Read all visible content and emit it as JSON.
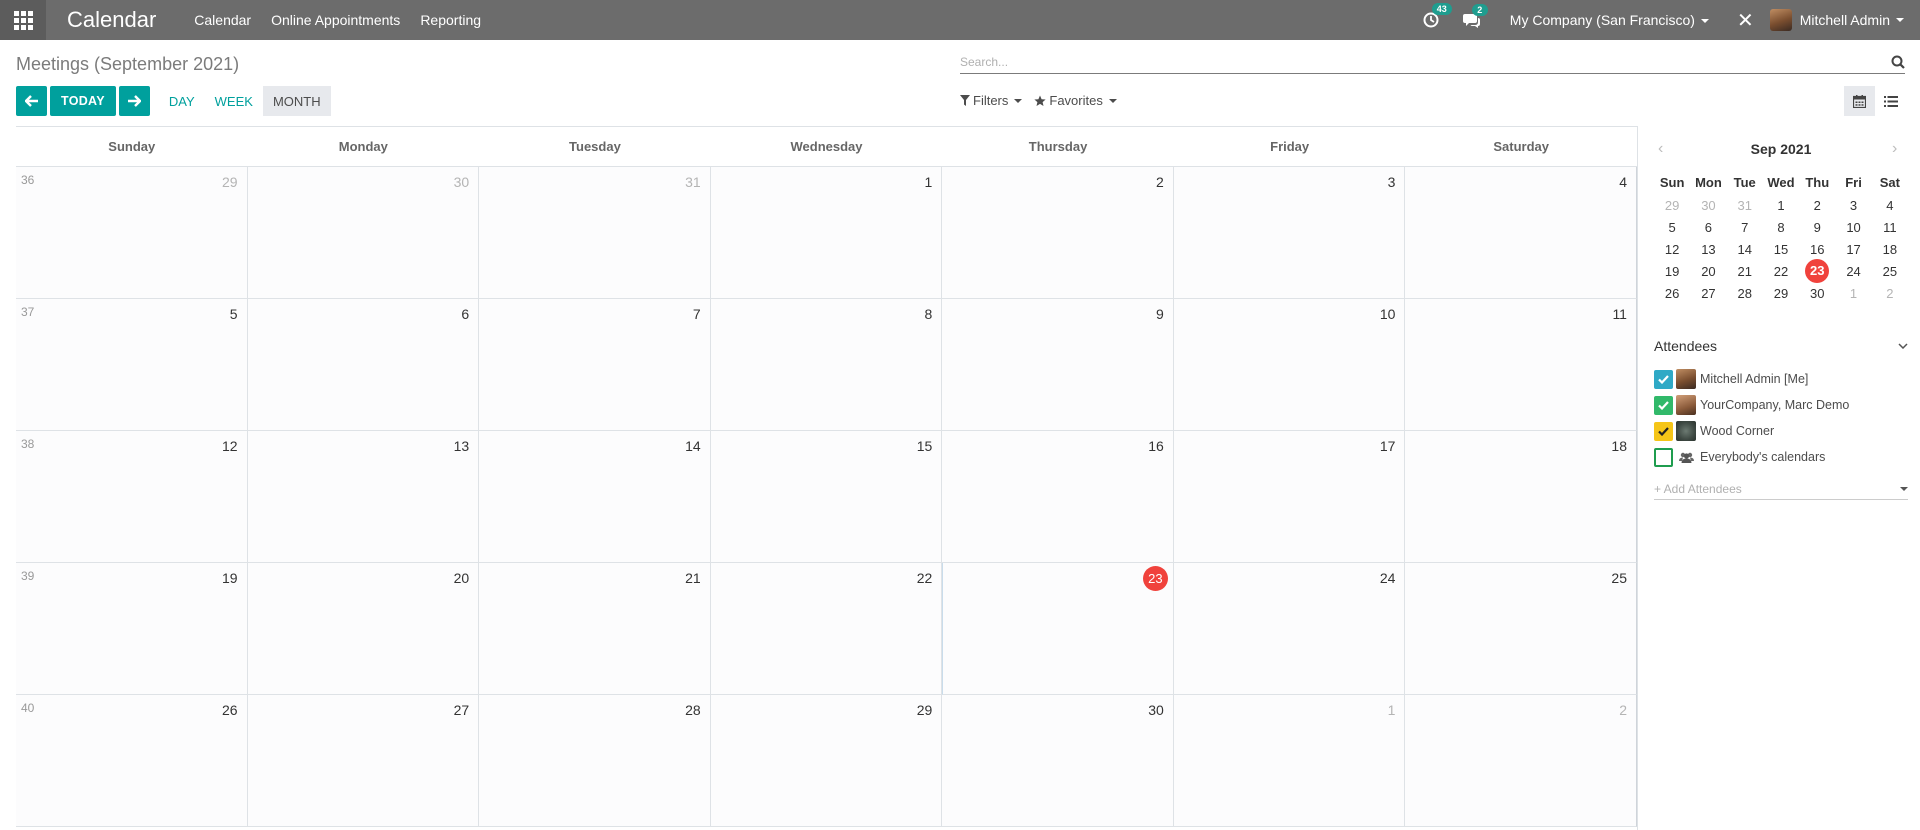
{
  "navbar": {
    "app_title": "Calendar",
    "menu": [
      "Calendar",
      "Online Appointments",
      "Reporting"
    ],
    "activity_count": "43",
    "message_count": "2",
    "company": "My Company (San Francisco)",
    "user": "Mitchell Admin",
    "colors": {
      "bg": "#6c6c6c",
      "badge": "#1f9d8f"
    }
  },
  "control_panel": {
    "title": "Meetings (September 2021)",
    "search_placeholder": "Search...",
    "today_label": "TODAY",
    "scales": [
      "DAY",
      "WEEK",
      "MONTH"
    ],
    "active_scale": "MONTH",
    "filters_label": "Filters",
    "favorites_label": "Favorites",
    "views": [
      "calendar",
      "list"
    ],
    "active_view": "calendar"
  },
  "calendar": {
    "weekdays": [
      "Sunday",
      "Monday",
      "Tuesday",
      "Wednesday",
      "Thursday",
      "Friday",
      "Saturday"
    ],
    "today": "23",
    "weeks": [
      {
        "number": "36",
        "days": [
          {
            "d": "29",
            "other": true
          },
          {
            "d": "30",
            "other": true
          },
          {
            "d": "31",
            "other": true
          },
          {
            "d": "1"
          },
          {
            "d": "2"
          },
          {
            "d": "3"
          },
          {
            "d": "4"
          }
        ]
      },
      {
        "number": "37",
        "days": [
          {
            "d": "5"
          },
          {
            "d": "6"
          },
          {
            "d": "7"
          },
          {
            "d": "8"
          },
          {
            "d": "9"
          },
          {
            "d": "10"
          },
          {
            "d": "11"
          }
        ]
      },
      {
        "number": "38",
        "days": [
          {
            "d": "12"
          },
          {
            "d": "13"
          },
          {
            "d": "14"
          },
          {
            "d": "15"
          },
          {
            "d": "16"
          },
          {
            "d": "17"
          },
          {
            "d": "18"
          }
        ]
      },
      {
        "number": "39",
        "days": [
          {
            "d": "19"
          },
          {
            "d": "20"
          },
          {
            "d": "21"
          },
          {
            "d": "22"
          },
          {
            "d": "23",
            "today": true
          },
          {
            "d": "24"
          },
          {
            "d": "25"
          }
        ]
      },
      {
        "number": "40",
        "days": [
          {
            "d": "26"
          },
          {
            "d": "27"
          },
          {
            "d": "28"
          },
          {
            "d": "29"
          },
          {
            "d": "30"
          },
          {
            "d": "1",
            "other": true
          },
          {
            "d": "2",
            "other": true
          }
        ]
      }
    ]
  },
  "mini_calendar": {
    "title": "Sep 2021",
    "weekdays": [
      "Sun",
      "Mon",
      "Tue",
      "Wed",
      "Thu",
      "Fri",
      "Sat"
    ],
    "rows": [
      [
        {
          "d": "29",
          "o": true
        },
        {
          "d": "30",
          "o": true
        },
        {
          "d": "31",
          "o": true
        },
        {
          "d": "1"
        },
        {
          "d": "2"
        },
        {
          "d": "3"
        },
        {
          "d": "4"
        }
      ],
      [
        {
          "d": "5"
        },
        {
          "d": "6"
        },
        {
          "d": "7"
        },
        {
          "d": "8"
        },
        {
          "d": "9"
        },
        {
          "d": "10"
        },
        {
          "d": "11"
        }
      ],
      [
        {
          "d": "12"
        },
        {
          "d": "13"
        },
        {
          "d": "14"
        },
        {
          "d": "15"
        },
        {
          "d": "16"
        },
        {
          "d": "17"
        },
        {
          "d": "18"
        }
      ],
      [
        {
          "d": "19"
        },
        {
          "d": "20"
        },
        {
          "d": "21"
        },
        {
          "d": "22"
        },
        {
          "d": "23",
          "sel": true
        },
        {
          "d": "24"
        },
        {
          "d": "25"
        }
      ],
      [
        {
          "d": "26"
        },
        {
          "d": "27"
        },
        {
          "d": "28"
        },
        {
          "d": "29"
        },
        {
          "d": "30"
        },
        {
          "d": "1",
          "o": true
        },
        {
          "d": "2",
          "o": true
        }
      ]
    ],
    "accent": "#f0423c"
  },
  "attendees": {
    "title": "Attendees",
    "items": [
      {
        "label": "Mitchell Admin [Me]",
        "checked": true,
        "color": "#2fa9c6",
        "avatar": "av-mitchell"
      },
      {
        "label": "YourCompany, Marc Demo",
        "checked": true,
        "color": "#31b96a",
        "avatar": "av-marc"
      },
      {
        "label": "Wood Corner",
        "checked": true,
        "color": "#f5c518",
        "check_color": "#222",
        "avatar": "av-wood"
      },
      {
        "label": "Everybody's calendars",
        "checked": false,
        "color": "#ffffff",
        "avatar": "group"
      }
    ],
    "add_placeholder": "+ Add Attendees"
  }
}
